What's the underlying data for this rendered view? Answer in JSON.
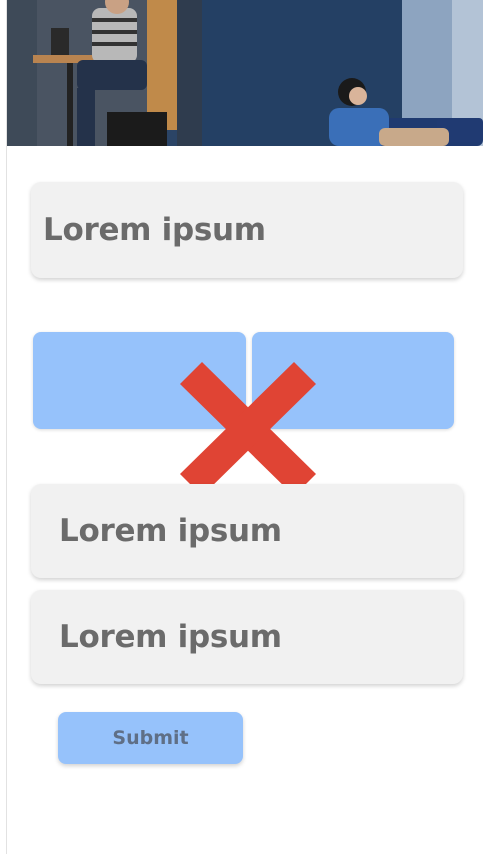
{
  "form": {
    "field1_text": "Lorem ipsum",
    "field2_text": "Lorem ipsum",
    "field3_text": "Lorem ipsum",
    "submit_label": "Submit"
  },
  "colors": {
    "card_bg": "#f1f1f1",
    "accent_blue": "#96c2fb",
    "error_red": "#e04434",
    "text_gray": "#6b6b6b"
  },
  "icons": {
    "x_mark": "close-icon"
  }
}
